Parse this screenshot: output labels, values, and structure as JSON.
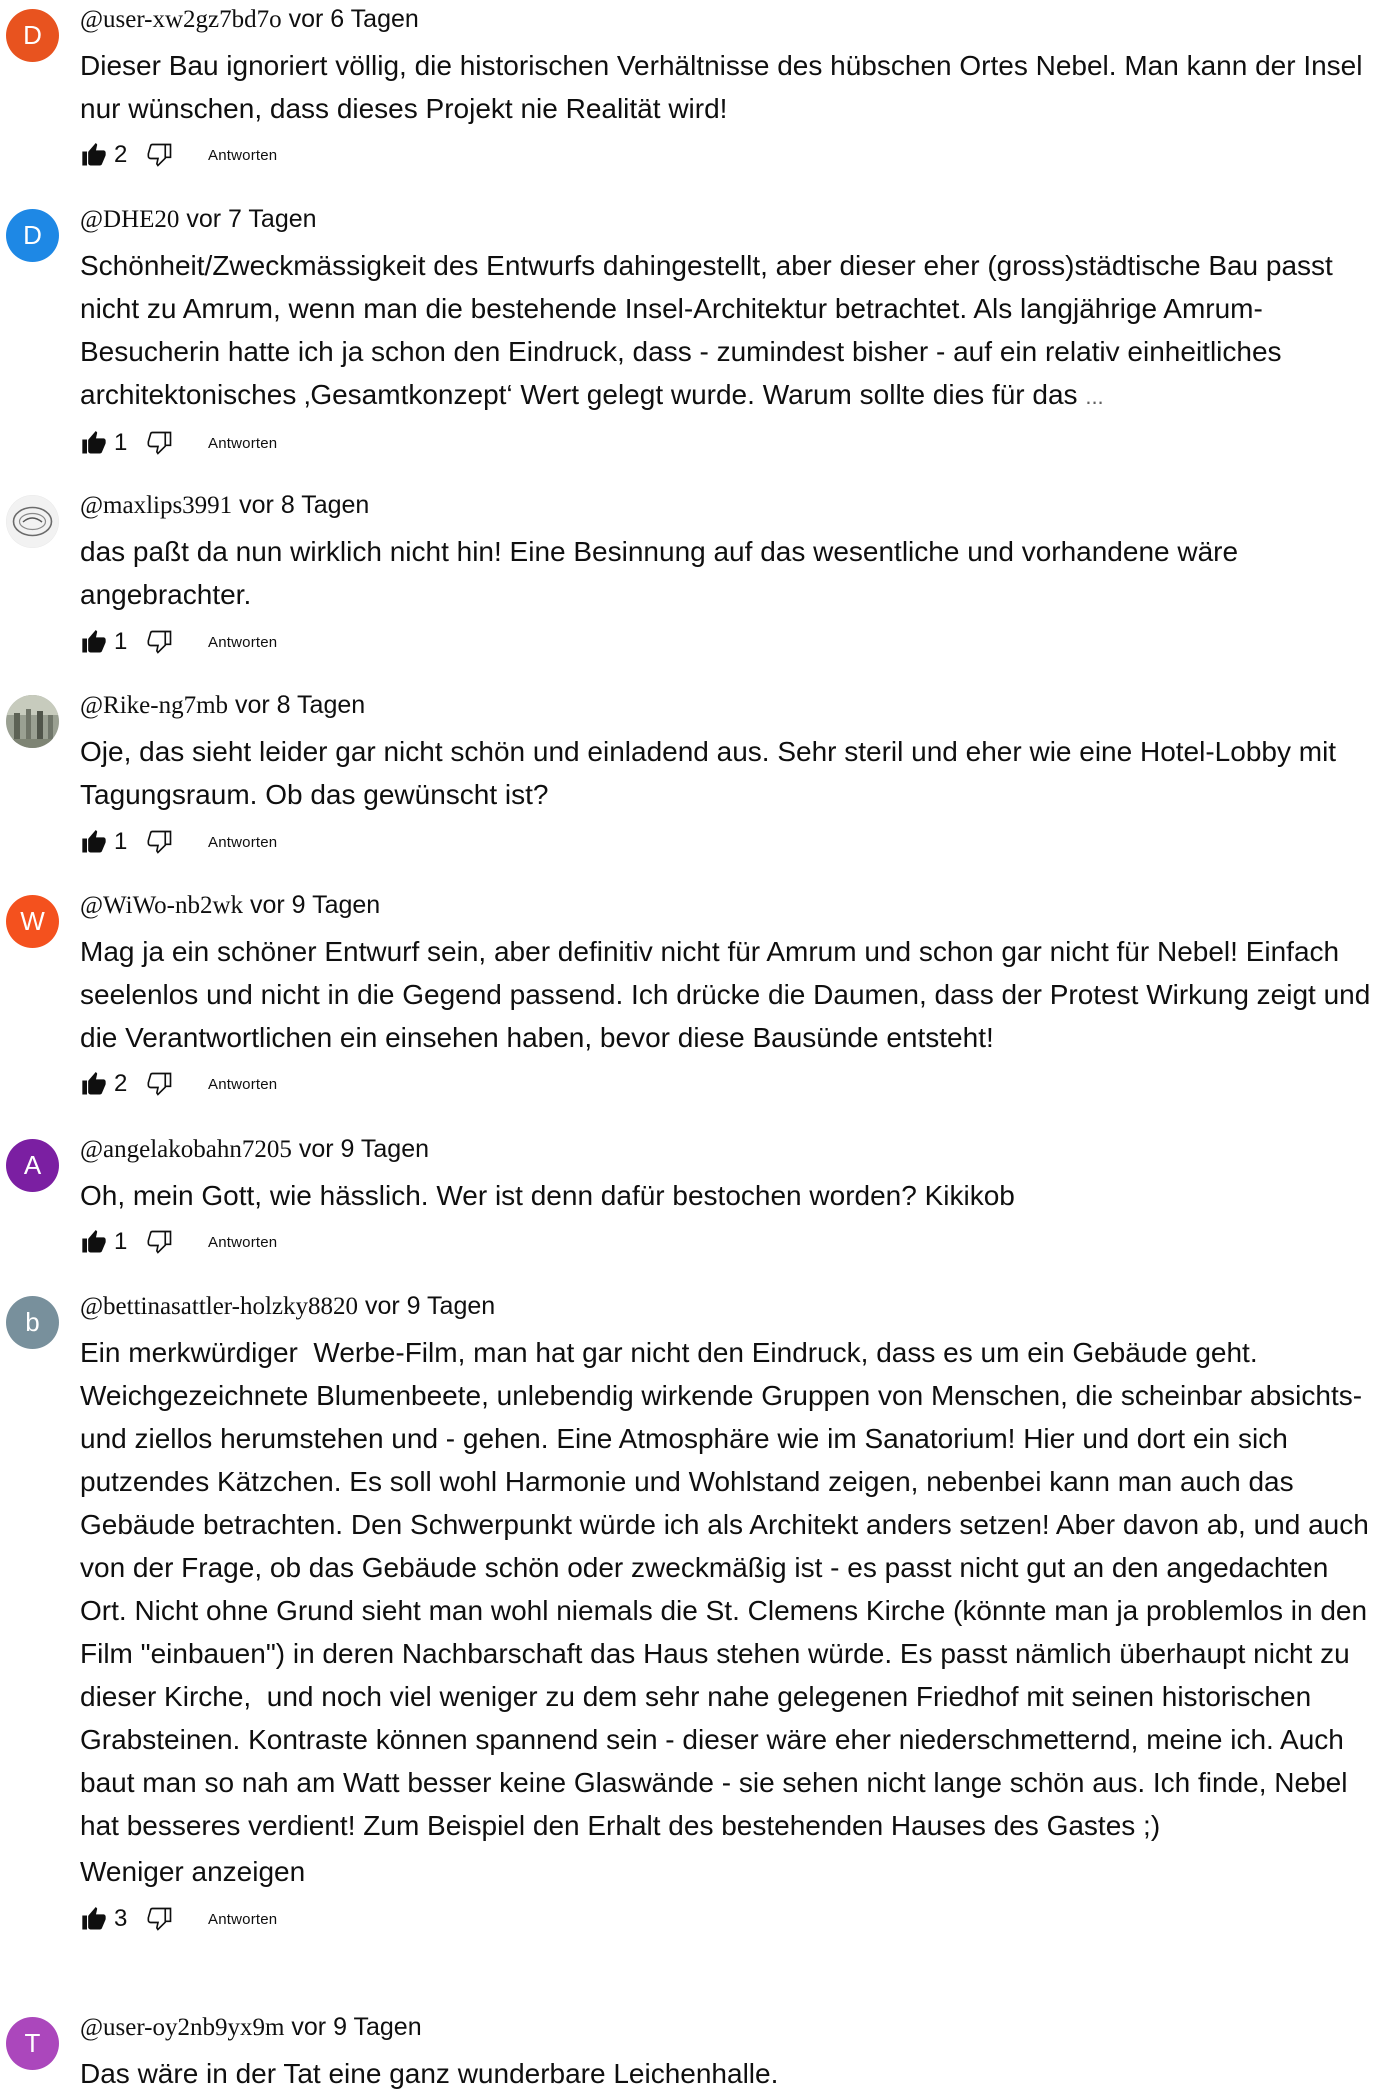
{
  "comments": [
    {
      "username": "@user-xw2gz7bd7o",
      "time": "vor 6 Tagen",
      "avatar": {
        "letter": "D",
        "color": "#e8531f"
      },
      "text": "Dieser Bau ignoriert völlig, die historischen Verhältnisse des hübschen Ortes Nebel. Man kann der Insel nur wünschen, dass dieses Projekt nie Realität wird!",
      "likes": "2",
      "reply": "Antworten"
    },
    {
      "username": "@DHE20",
      "time": "vor 7 Tagen",
      "avatar": {
        "letter": "D",
        "color": "#1e88e5"
      },
      "text": "Schönheit/Zweckmässigkeit des Entwurfs dahingestellt, aber dieser eher (gross)städtische Bau passt nicht zu Amrum, wenn man die bestehende Insel-Architektur betrachtet. Als langjährige Amrum-Besucherin hatte ich ja schon den Eindruck, dass - zumindest bisher - auf ein relativ einheitliches architektonisches ‚Gesamtkonzept‘ Wert gelegt wurde. Warum sollte dies für das",
      "ellipsis": "...",
      "likes": "1",
      "reply": "Antworten"
    },
    {
      "username": "@maxlips3991",
      "time": "vor 8 Tagen",
      "avatar": {
        "letter": "",
        "color": "#e9e9e9",
        "image": "stamp-logo-avatar"
      },
      "text": "das paßt da nun wirklich nicht hin! Eine Besinnung auf das wesentliche und vorhandene wäre angebrachter.",
      "likes": "1",
      "reply": "Antworten"
    },
    {
      "username": "@Rike-ng7mb",
      "time": "vor 8 Tagen",
      "avatar": {
        "letter": "",
        "color": "#8a8f7a",
        "image": "photo-avatar"
      },
      "text": "Oje, das sieht leider gar nicht schön und einladend aus. Sehr steril und eher wie eine Hotel-Lobby mit Tagungsraum. Ob das gewünscht ist?",
      "likes": "1",
      "reply": "Antworten"
    },
    {
      "username": "@WiWo-nb2wk",
      "time": "vor 9 Tagen",
      "avatar": {
        "letter": "W",
        "color": "#f4511e"
      },
      "text": "Mag ja ein schöner Entwurf sein, aber definitiv nicht für Amrum und schon gar nicht für Nebel! Einfach seelenlos und nicht in die Gegend passend. Ich drücke die Daumen, dass der Protest Wirkung zeigt und die Verantwortlichen ein einsehen haben, bevor diese Bausünde entsteht!",
      "likes": "2",
      "reply": "Antworten"
    },
    {
      "username": "@angelakobahn7205",
      "time": "vor 9 Tagen",
      "avatar": {
        "letter": "A",
        "color": "#7b1fa2"
      },
      "text": "Oh, mein Gott, wie hässlich. Wer ist denn dafür bestochen worden? Kikikob",
      "likes": "1",
      "reply": "Antworten"
    },
    {
      "username": "@bettinasattler-holzky8820",
      "time": "vor 9 Tagen",
      "avatar": {
        "letter": "b",
        "color": "#78909c"
      },
      "text": "Ein merkwürdiger  Werbe-Film, man hat gar nicht den Eindruck, dass es um ein Gebäude geht. Weichgezeichnete Blumenbeete, unlebendig wirkende Gruppen von Menschen, die scheinbar absichts- und ziellos herumstehen und - gehen. Eine Atmosphäre wie im Sanatorium! Hier und dort ein sich putzendes Kätzchen. Es soll wohl Harmonie und Wohlstand zeigen, nebenbei kann man auch das Gebäude betrachten. Den Schwerpunkt würde ich als Architekt anders setzen! Aber davon ab, und auch von der Frage, ob das Gebäude schön oder zweckmäßig ist - es passt nicht gut an den angedachten Ort. Nicht ohne Grund sieht man wohl niemals die St. Clemens Kirche (könnte man ja problemlos in den Film \"einbauen\") in deren Nachbarschaft das Haus stehen würde. Es passt nämlich überhaupt nicht zu dieser Kirche,  und noch viel weniger zu dem sehr nahe gelegenen Friedhof mit seinen historischen Grabsteinen. Kontraste können spannend sein - dieser wäre eher niederschmetternd, meine ich. Auch baut man so nah am Watt besser keine Glaswände - sie sehen nicht lange schön aus. Ich finde, Nebel hat besseres verdient! Zum Beispiel den Erhalt des bestehenden Hauses des Gastes ;)",
      "show_less": "Weniger anzeigen",
      "likes": "3",
      "reply": "Antworten"
    },
    {
      "username": "@user-oy2nb9yx9m",
      "time": "vor 9 Tagen",
      "avatar": {
        "letter": "T",
        "color": "#ab47bc"
      },
      "text": "Das wäre in der Tat eine ganz wunderbare Leichenhalle.",
      "likes": "",
      "reply": ""
    }
  ]
}
